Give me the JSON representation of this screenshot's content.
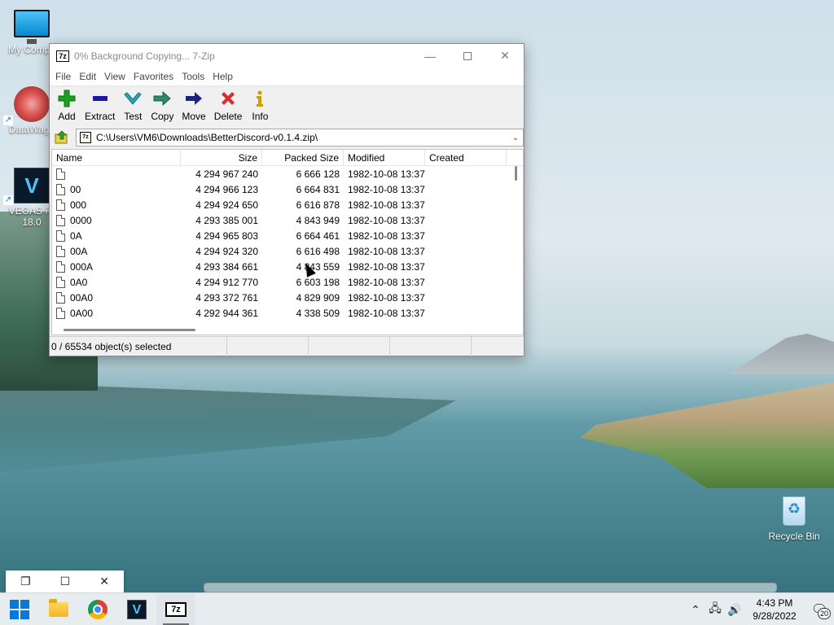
{
  "desktop": {
    "icons": [
      {
        "label": "My Compu"
      },
      {
        "label": "DataWago"
      },
      {
        "label": "VEGAS Pr\n18.0"
      },
      {
        "label": "Recycle Bin"
      }
    ]
  },
  "window": {
    "title": "0% Background Copying... 7-Zip",
    "icon_text": "7z",
    "menu": [
      "File",
      "Edit",
      "View",
      "Favorites",
      "Tools",
      "Help"
    ],
    "toolbar": [
      {
        "label": "Add",
        "icon": "plus-icon",
        "color": "#1aa31a"
      },
      {
        "label": "Extract",
        "icon": "minus-icon",
        "color": "#1a1aa0"
      },
      {
        "label": "Test",
        "icon": "check-icon",
        "color": "#2aa8b8"
      },
      {
        "label": "Copy",
        "icon": "copy-arrow-icon",
        "color": "#2e8b6f"
      },
      {
        "label": "Move",
        "icon": "move-arrow-icon",
        "color": "#1a237e"
      },
      {
        "label": "Delete",
        "icon": "x-icon",
        "color": "#d32f2f"
      },
      {
        "label": "Info",
        "icon": "info-icon",
        "color": "#c6a100"
      }
    ],
    "address": "C:\\Users\\VM6\\Downloads\\BetterDiscord-v0.1.4.zip\\",
    "columns": [
      "Name",
      "Size",
      "Packed Size",
      "Modified",
      "Created"
    ],
    "rows": [
      {
        "name": "",
        "size": "4 294 967 240",
        "packed": "6 666 128",
        "modified": "1982-10-08 13:37",
        "created": ""
      },
      {
        "name": "00",
        "size": "4 294 966 123",
        "packed": "6 664 831",
        "modified": "1982-10-08 13:37",
        "created": ""
      },
      {
        "name": "000",
        "size": "4 294 924 650",
        "packed": "6 616 878",
        "modified": "1982-10-08 13:37",
        "created": ""
      },
      {
        "name": "0000",
        "size": "4 293 385 001",
        "packed": "4 843 949",
        "modified": "1982-10-08 13:37",
        "created": ""
      },
      {
        "name": "0A",
        "size": "4 294 965 803",
        "packed": "6 664 461",
        "modified": "1982-10-08 13:37",
        "created": ""
      },
      {
        "name": "00A",
        "size": "4 294 924 320",
        "packed": "6 616 498",
        "modified": "1982-10-08 13:37",
        "created": ""
      },
      {
        "name": "000A",
        "size": "4 293 384 661",
        "packed": "4 843 559",
        "modified": "1982-10-08 13:37",
        "created": ""
      },
      {
        "name": "0A0",
        "size": "4 294 912 770",
        "packed": "6 603 198",
        "modified": "1982-10-08 13:37",
        "created": ""
      },
      {
        "name": "00A0",
        "size": "4 293 372 761",
        "packed": "4 829 909",
        "modified": "1982-10-08 13:37",
        "created": ""
      },
      {
        "name": "0A00",
        "size": "4 292 944 361",
        "packed": "4 338 509",
        "modified": "1982-10-08 13:37",
        "created": ""
      }
    ],
    "status": [
      "0 / 65534 object(s) selected",
      "",
      "",
      ""
    ]
  },
  "taskbar": {
    "apps": [
      {
        "name": "start",
        "icon": "windows-logo-icon"
      },
      {
        "name": "file-explorer",
        "icon": "folder-icon"
      },
      {
        "name": "chrome",
        "icon": "chrome-icon"
      },
      {
        "name": "vegas",
        "icon": "vegas-icon",
        "text": "V"
      },
      {
        "name": "7zip",
        "icon": "7zip-icon",
        "text": "7z"
      }
    ],
    "time": "4:43 PM",
    "date": "9/28/2022",
    "notification_count": "20"
  }
}
